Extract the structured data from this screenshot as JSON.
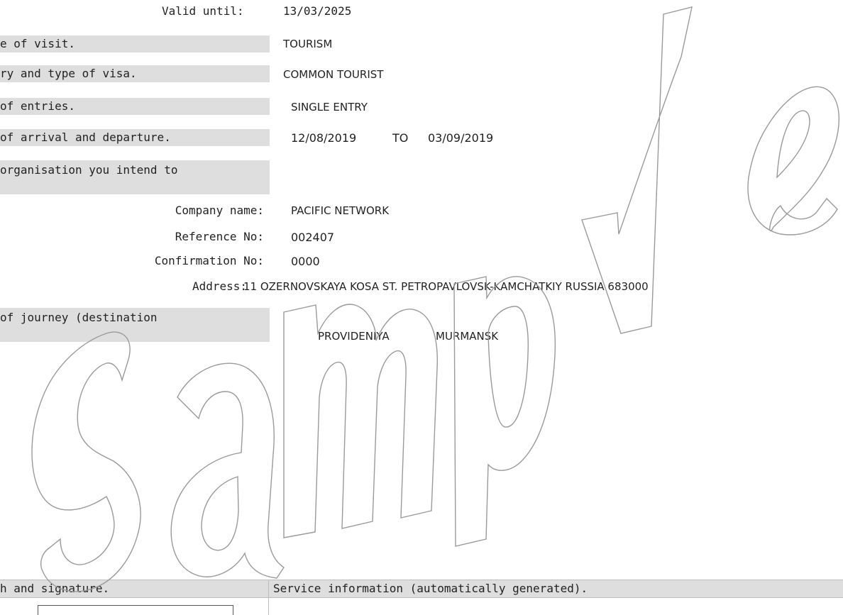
{
  "valid_until": {
    "label": "Valid until:",
    "value": "13/03/2025"
  },
  "rows": {
    "purpose": {
      "label": "e of visit.",
      "value": "TOURISM"
    },
    "category": {
      "label": "ry and type of visa.",
      "value": "COMMON TOURIST"
    },
    "entries": {
      "label": " of entries.",
      "value": "SINGLE ENTRY"
    },
    "dates": {
      "label": "of arrival and departure.",
      "from": "12/08/2019",
      "to_word": "TO",
      "to": "03/09/2019"
    },
    "organisation": {
      "label": "organisation you intend to"
    },
    "journey": {
      "label": " of journey (destination",
      "places": [
        "PROVIDENIYA",
        "MURMANSK"
      ]
    }
  },
  "organisation": {
    "company_label": "Company name:",
    "company_value": "PACIFIC NETWORK",
    "reference_label": "Reference No:",
    "reference_value": "002407",
    "confirmation_label": "Confirmation No:",
    "confirmation_value": "0000",
    "address_label": "Address:",
    "address_value": "11 OZERNOVSKAYA KOSA ST. PETROPAVLOVSK-KAMCHATKIY RUSSIA 683000"
  },
  "bottom": {
    "left_header": "h and signature.",
    "right_header": "Service information (automatically generated)."
  },
  "watermark": {
    "text": "Sample",
    "color": "#9a9a9a"
  },
  "colors": {
    "band": "#dedede",
    "text": "#222222"
  }
}
